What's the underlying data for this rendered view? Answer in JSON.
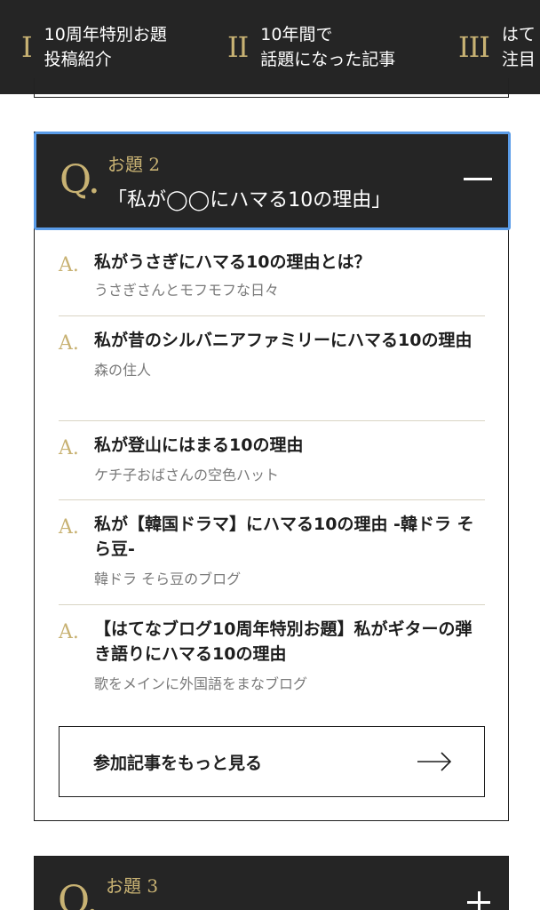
{
  "nav": [
    {
      "numeral": "I",
      "lines": [
        "10周年特別お題",
        "投稿紹介"
      ]
    },
    {
      "numeral": "II",
      "lines": [
        "10年間で",
        "話題になった記事"
      ]
    },
    {
      "numeral": "III",
      "lines": [
        "はて",
        "注目"
      ]
    }
  ],
  "q2": {
    "mark": "Q.",
    "subtitle": "お題 2",
    "title": "「私が◯◯にハマる10の理由」",
    "answers": [
      {
        "mark": "A.",
        "title": "私がうさぎにハマる10の理由とは？",
        "blog": "うさぎさんとモフモフな日々"
      },
      {
        "mark": "A.",
        "title": "私が昔のシルバニアファミリーにハマる10の理由",
        "blog": "森の住人"
      },
      {
        "mark": "A.",
        "title": "私が登山にはまる10の理由",
        "blog": "ケチ子おばさんの空色ハット"
      },
      {
        "mark": "A.",
        "title": "私が【韓国ドラマ】にハマる10の理由 -韓ドラ そら豆-",
        "blog": "韓ドラ そら豆のブログ"
      },
      {
        "mark": "A.",
        "title": "【はてなブログ10周年特別お題】私がギターの弾き語りにハマる10の理由",
        "blog": "歌をメインに外国語をまなブログ"
      }
    ],
    "more_label": "参加記事をもっと見る"
  },
  "q3": {
    "mark": "Q.",
    "subtitle": "お題 3"
  },
  "colors": {
    "header_bg": "#252525",
    "gold": "#c8b273",
    "focus_ring": "#5a9ce8"
  }
}
